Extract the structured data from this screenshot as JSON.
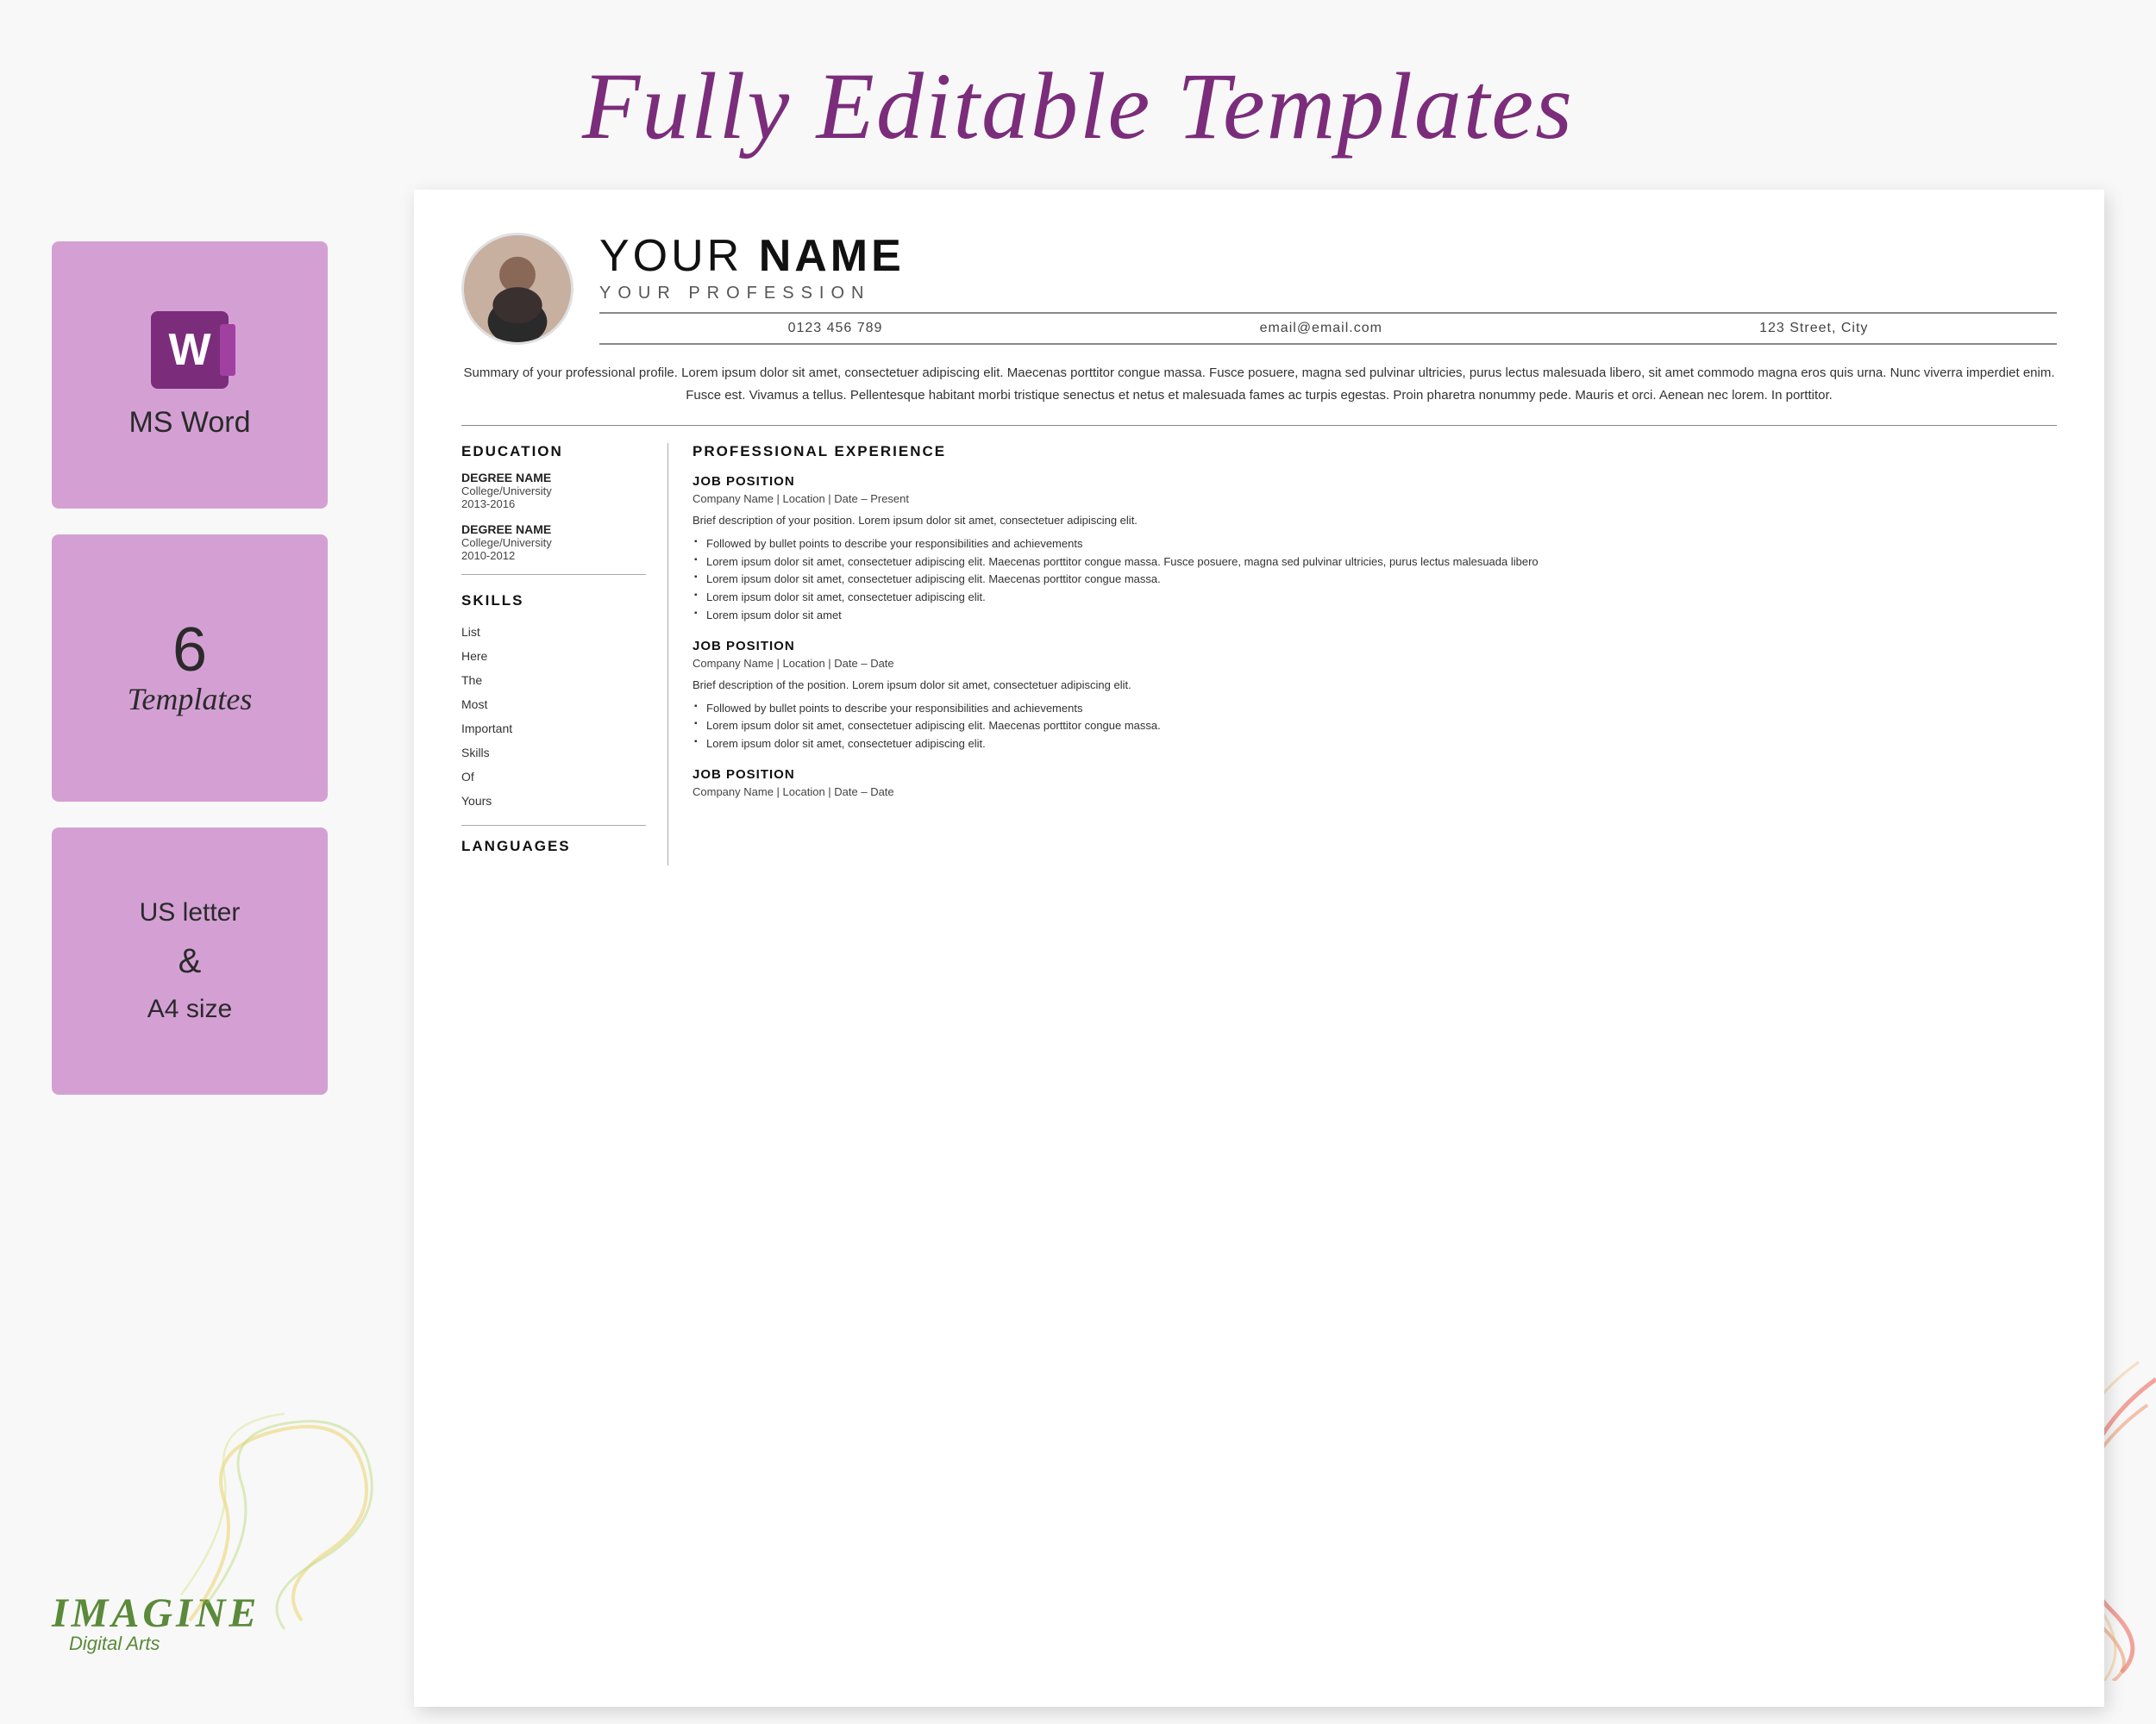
{
  "page": {
    "title": "Fully Editable Templates",
    "background_color": "#f8f8f8"
  },
  "header": {
    "title_part1": "Fully Editable ",
    "title_part2": "Templates"
  },
  "left_panel": {
    "ms_word_badge": {
      "label": "MS Word"
    },
    "templates_badge": {
      "number": "6",
      "label": "Templates"
    },
    "size_badge": {
      "line1": "US letter",
      "line2": "&",
      "line3": "A4 size"
    }
  },
  "logo": {
    "main": "IMAGINE",
    "sub": "Digital Arts"
  },
  "resume": {
    "name_regular": "YOUR ",
    "name_bold": "NAME",
    "profession": "YOUR PROFESSION",
    "contact": {
      "phone": "0123 456 789",
      "email": "email@email.com",
      "address": "123 Street, City"
    },
    "summary": "Summary of your professional profile. Lorem ipsum dolor sit amet, consectetuer adipiscing elit. Maecenas porttitor congue massa. Fusce posuere, magna sed pulvinar ultricies, purus lectus malesuada libero, sit amet commodo magna eros quis urna. Nunc viverra imperdiet enim. Fusce est. Vivamus a tellus. Pellentesque habitant morbi tristique senectus et netus et malesuada fames ac turpis egestas. Proin pharetra nonummy pede. Mauris et orci. Aenean nec lorem. In porttitor.",
    "education": {
      "title": "EDUCATION",
      "entries": [
        {
          "degree": "DEGREE NAME",
          "school": "College/University",
          "years": "2013-2016"
        },
        {
          "degree": "DEGREE NAME",
          "school": "College/University",
          "years": "2010-2012"
        }
      ]
    },
    "skills": {
      "title": "SKILLS",
      "items": [
        "List",
        "Here",
        "The",
        "Most",
        "Important",
        "Skills",
        "Of",
        "Yours"
      ]
    },
    "languages": {
      "title": "LANGUAGES"
    },
    "experience": {
      "title": "PROFESSIONAL EXPERIENCE",
      "jobs": [
        {
          "title": "JOB POSITION",
          "company": "Company Name | Location | Date – Present",
          "description": "Brief description of your position. Lorem ipsum dolor sit amet, consectetuer adipiscing elit.",
          "bullets": [
            "Followed by bullet points to describe your responsibilities and achievements",
            "Lorem ipsum dolor sit amet, consectetuer adipiscing elit. Maecenas porttitor congue massa. Fusce posuere, magna sed pulvinar ultricies, purus lectus malesuada libero",
            "Lorem ipsum dolor sit amet, consectetuer adipiscing elit. Maecenas porttitor congue massa.",
            "Lorem ipsum dolor sit amet, consectetuer adipiscing elit.",
            "Lorem ipsum dolor sit amet"
          ]
        },
        {
          "title": "JOB POSITION",
          "company": "Company Name | Location | Date – Date",
          "description": "Brief description of the position. Lorem ipsum dolor sit amet, consectetuer adipiscing elit.",
          "bullets": [
            "Followed by bullet points to describe your responsibilities and achievements",
            "Lorem ipsum dolor sit amet, consectetuer adipiscing elit. Maecenas porttitor congue massa.",
            "Lorem ipsum dolor sit amet, consectetuer adipiscing elit."
          ]
        },
        {
          "title": "JOB POSITION",
          "company": "Company Name | Location | Date – Date",
          "description": "",
          "bullets": []
        }
      ]
    }
  }
}
